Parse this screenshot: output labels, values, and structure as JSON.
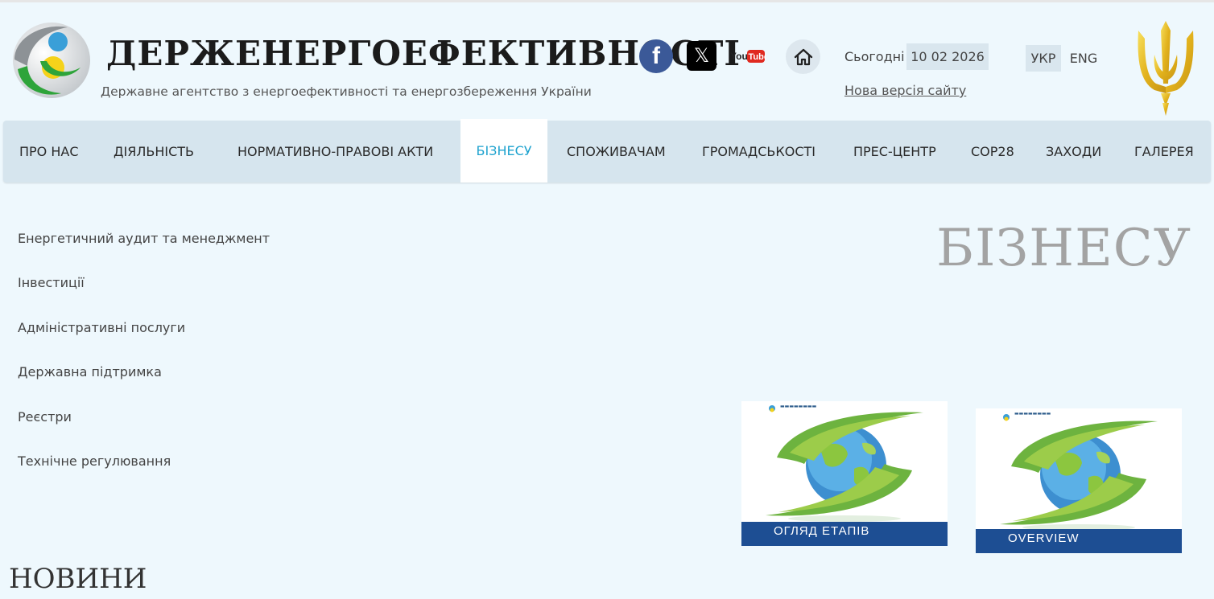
{
  "header": {
    "site_title": "ДЕРЖЕНЕРГОЕФЕКТИВНОСТІ",
    "site_subtitle": "Державне агентство з енергоефективності та енергозбереження України",
    "social": {
      "facebook_icon": "facebook-icon",
      "x_icon": "x-icon",
      "youtube_icon": "youtube-icon",
      "youtube_text": "YouTube",
      "home_icon": "home-icon"
    },
    "today_label": "Сьогодні",
    "today_date": "10 02 2026",
    "new_version_link": "Нова версія сайту",
    "languages": [
      "УКР",
      "ENG"
    ],
    "active_language": "УКР"
  },
  "nav": {
    "items": [
      "ПРО НАС",
      "ДІЯЛЬНІСТЬ",
      "НОРМАТИВНО-ПРАВОВІ АКТИ",
      "БІЗНЕСУ",
      "СПОЖИВАЧАМ",
      "ГРОМАДСЬКОСТІ",
      "ПРЕС-ЦЕНТР",
      "COP28",
      "ЗАХОДИ",
      "ГАЛЕРЕЯ"
    ],
    "active": "БІЗНЕСУ"
  },
  "sidebar": {
    "items": [
      "Енергетичний аудит та менеджмент",
      "Інвестиції",
      "Адміністративні послуги",
      "Державна підтримка",
      "Реєстри",
      "Технічне регулювання"
    ]
  },
  "main": {
    "page_heading": "БІЗНЕСУ",
    "news_heading": "НОВИНИ",
    "covers": [
      {
        "title": "ОГЛЯД ЕТАПІВ"
      },
      {
        "title": "OVERVIEW"
      }
    ]
  },
  "colors": {
    "background": "#eef8fd",
    "nav_background": "#d6e5ee",
    "active_nav_text": "#1fa3cf",
    "cover_band": "#1d4e93",
    "heading_gray": "#a3a3a3"
  }
}
